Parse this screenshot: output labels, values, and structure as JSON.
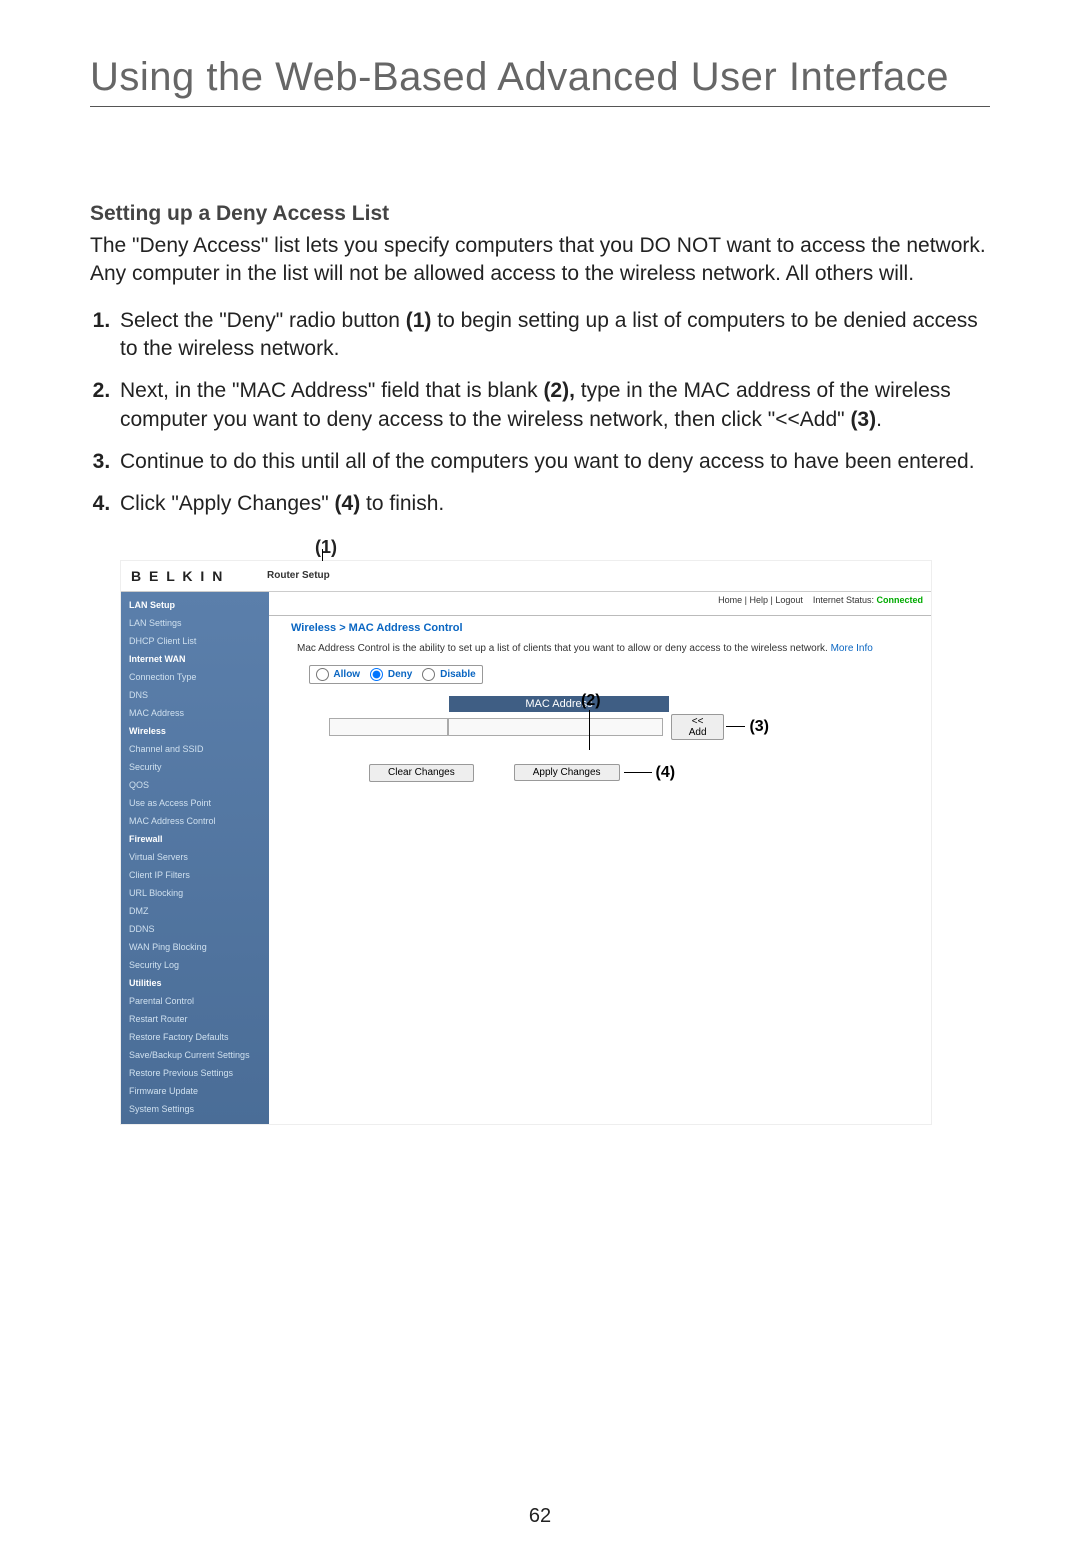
{
  "page_title": "Using the Web-Based Advanced User Interface",
  "section_heading": "Setting up a Deny Access List",
  "intro": "The \"Deny Access\" list lets you specify computers that you DO NOT want to access the network. Any computer in the list will not be allowed access to the wireless network. All others will.",
  "steps": {
    "s1a": "Select the \"Deny\" radio button ",
    "s1b": "(1)",
    "s1c": " to begin setting up a list of computers to be denied access to the wireless network.",
    "s2a": "Next, in the \"MAC Address\" field that is blank ",
    "s2b": "(2),",
    "s2c": " type in the MAC address of the wireless computer you want to deny access to the wireless network, then click \"<<Add\" ",
    "s2d": "(3)",
    "s2e": ".",
    "s3": "Continue to do this until all of the computers you want to deny access to have been entered.",
    "s4a": "Click \"Apply Changes\" ",
    "s4b": "(4)",
    "s4c": " to finish."
  },
  "callouts": {
    "c1": "(1)",
    "c2": "(2)",
    "c3": "(3)",
    "c4": "(4)"
  },
  "router": {
    "logo": "B E L K I N",
    "setup_label": "Router Setup",
    "topnav": {
      "links": "Home | Help | Logout",
      "status_label": "Internet Status:",
      "status_value": "Connected"
    },
    "breadcrumb": "Wireless > MAC Address Control",
    "desc_a": "Mac Address Control is the ability to set up a list of clients that you want to allow or deny access to the wireless network.",
    "desc_more": "More Info",
    "radios": {
      "allow": "Allow",
      "deny": "Deny",
      "disable": "Disable"
    },
    "mac_header": "MAC Address",
    "add_btn": "<< Add",
    "clear_btn": "Clear Changes",
    "apply_btn": "Apply Changes",
    "sidebar": [
      {
        "label": "LAN Setup",
        "cat": true
      },
      {
        "label": "LAN Settings"
      },
      {
        "label": "DHCP Client List"
      },
      {
        "label": "Internet WAN",
        "cat": true
      },
      {
        "label": "Connection Type"
      },
      {
        "label": "DNS"
      },
      {
        "label": "MAC Address"
      },
      {
        "label": "Wireless",
        "cat": true
      },
      {
        "label": "Channel and SSID"
      },
      {
        "label": "Security"
      },
      {
        "label": "QOS"
      },
      {
        "label": "Use as Access Point"
      },
      {
        "label": "MAC Address Control"
      },
      {
        "label": "Firewall",
        "cat": true
      },
      {
        "label": "Virtual Servers"
      },
      {
        "label": "Client IP Filters"
      },
      {
        "label": "URL Blocking"
      },
      {
        "label": "DMZ"
      },
      {
        "label": "DDNS"
      },
      {
        "label": "WAN Ping Blocking"
      },
      {
        "label": "Security Log"
      },
      {
        "label": "Utilities",
        "cat": true
      },
      {
        "label": "Parental Control"
      },
      {
        "label": "Restart Router"
      },
      {
        "label": "Restore Factory Defaults"
      },
      {
        "label": "Save/Backup Current Settings"
      },
      {
        "label": "Restore Previous Settings"
      },
      {
        "label": "Firmware Update"
      },
      {
        "label": "System Settings"
      }
    ]
  },
  "page_number": "62"
}
